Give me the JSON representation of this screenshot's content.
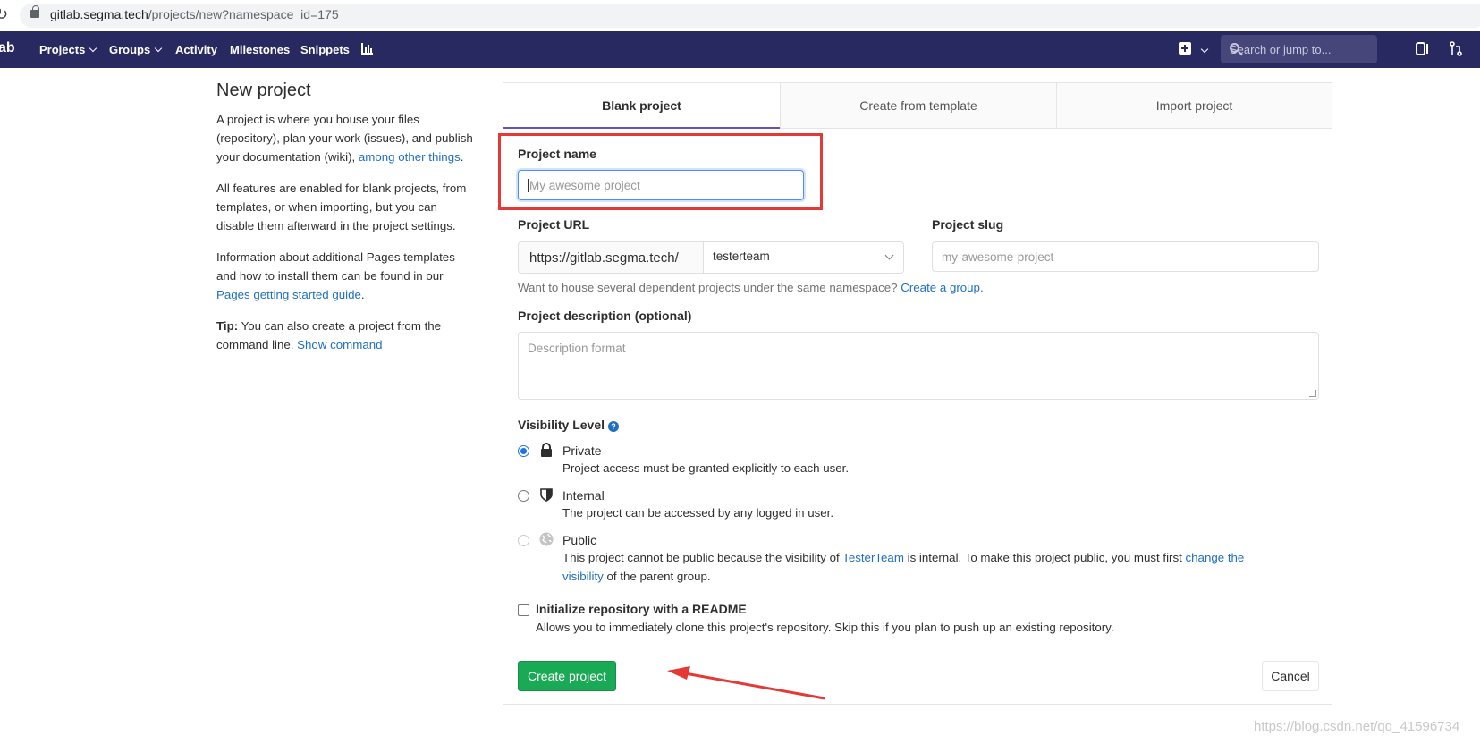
{
  "browser": {
    "url_host": "gitlab.segma.tech",
    "url_path": "/projects/new?namespace_id=175"
  },
  "navbar": {
    "brand": "ab",
    "items": [
      {
        "label": "Projects"
      },
      {
        "label": "Groups"
      },
      {
        "label": "Activity"
      },
      {
        "label": "Milestones"
      },
      {
        "label": "Snippets"
      }
    ],
    "search_placeholder": "Search or jump to...",
    "bg_color": "#292961"
  },
  "sidebar": {
    "title": "New project",
    "p1_text": "A project is where you house your files (repository), plan your work (issues), and publish your documentation (wiki),",
    "p1_link": "among other things",
    "p1_end": ".",
    "p2_text": "All features are enabled for blank projects, from templates, or when importing, but you can disable them afterward in the project settings.",
    "p3_text": "Information about additional Pages templates and how to install them can be found in our",
    "p3_link": "Pages getting started guide",
    "p3_end": ".",
    "tip_label": "Tip:",
    "tip_text": "You can also create a project from the command line.",
    "tip_link": "Show command"
  },
  "tabs": [
    {
      "label": "Blank project",
      "active": true
    },
    {
      "label": "Create from template",
      "active": false
    },
    {
      "label": "Import project",
      "active": false
    }
  ],
  "form": {
    "project_name_label": "Project name",
    "project_name_placeholder": "My awesome project",
    "project_url_label": "Project URL",
    "project_url_prefix": "https://gitlab.segma.tech/",
    "namespace_value": "testerteam",
    "project_slug_label": "Project slug",
    "project_slug_placeholder": "my-awesome-project",
    "namespace_help": "Want to house several dependent projects under the same namespace?",
    "namespace_help_link": "Create a group.",
    "description_label": "Project description (optional)",
    "description_placeholder": "Description format",
    "visibility_label": "Visibility Level",
    "visibility": [
      {
        "title": "Private",
        "desc": "Project access must be granted explicitly to each user.",
        "checked": true,
        "icon": "lock-icon"
      },
      {
        "title": "Internal",
        "desc": "The project can be accessed by any logged in user.",
        "checked": false,
        "icon": "shield-icon"
      },
      {
        "title": "Public",
        "desc_pre": "This project cannot be public because the visibility of",
        "desc_link1": "TesterTeam",
        "desc_mid": "is internal. To make this project public, you must first",
        "desc_link2": "change the visibility",
        "desc_end": "of the parent group.",
        "checked": false,
        "disabled": true,
        "icon": "globe-icon"
      }
    ],
    "readme_title": "Initialize repository with a README",
    "readme_desc": "Allows you to immediately clone this project's repository. Skip this if you plan to push up an existing repository.",
    "create_button": "Create project",
    "cancel_button": "Cancel"
  },
  "annotations": {
    "highlight_color": "#e53935"
  },
  "watermark": "https://blog.csdn.net/qq_41596734"
}
